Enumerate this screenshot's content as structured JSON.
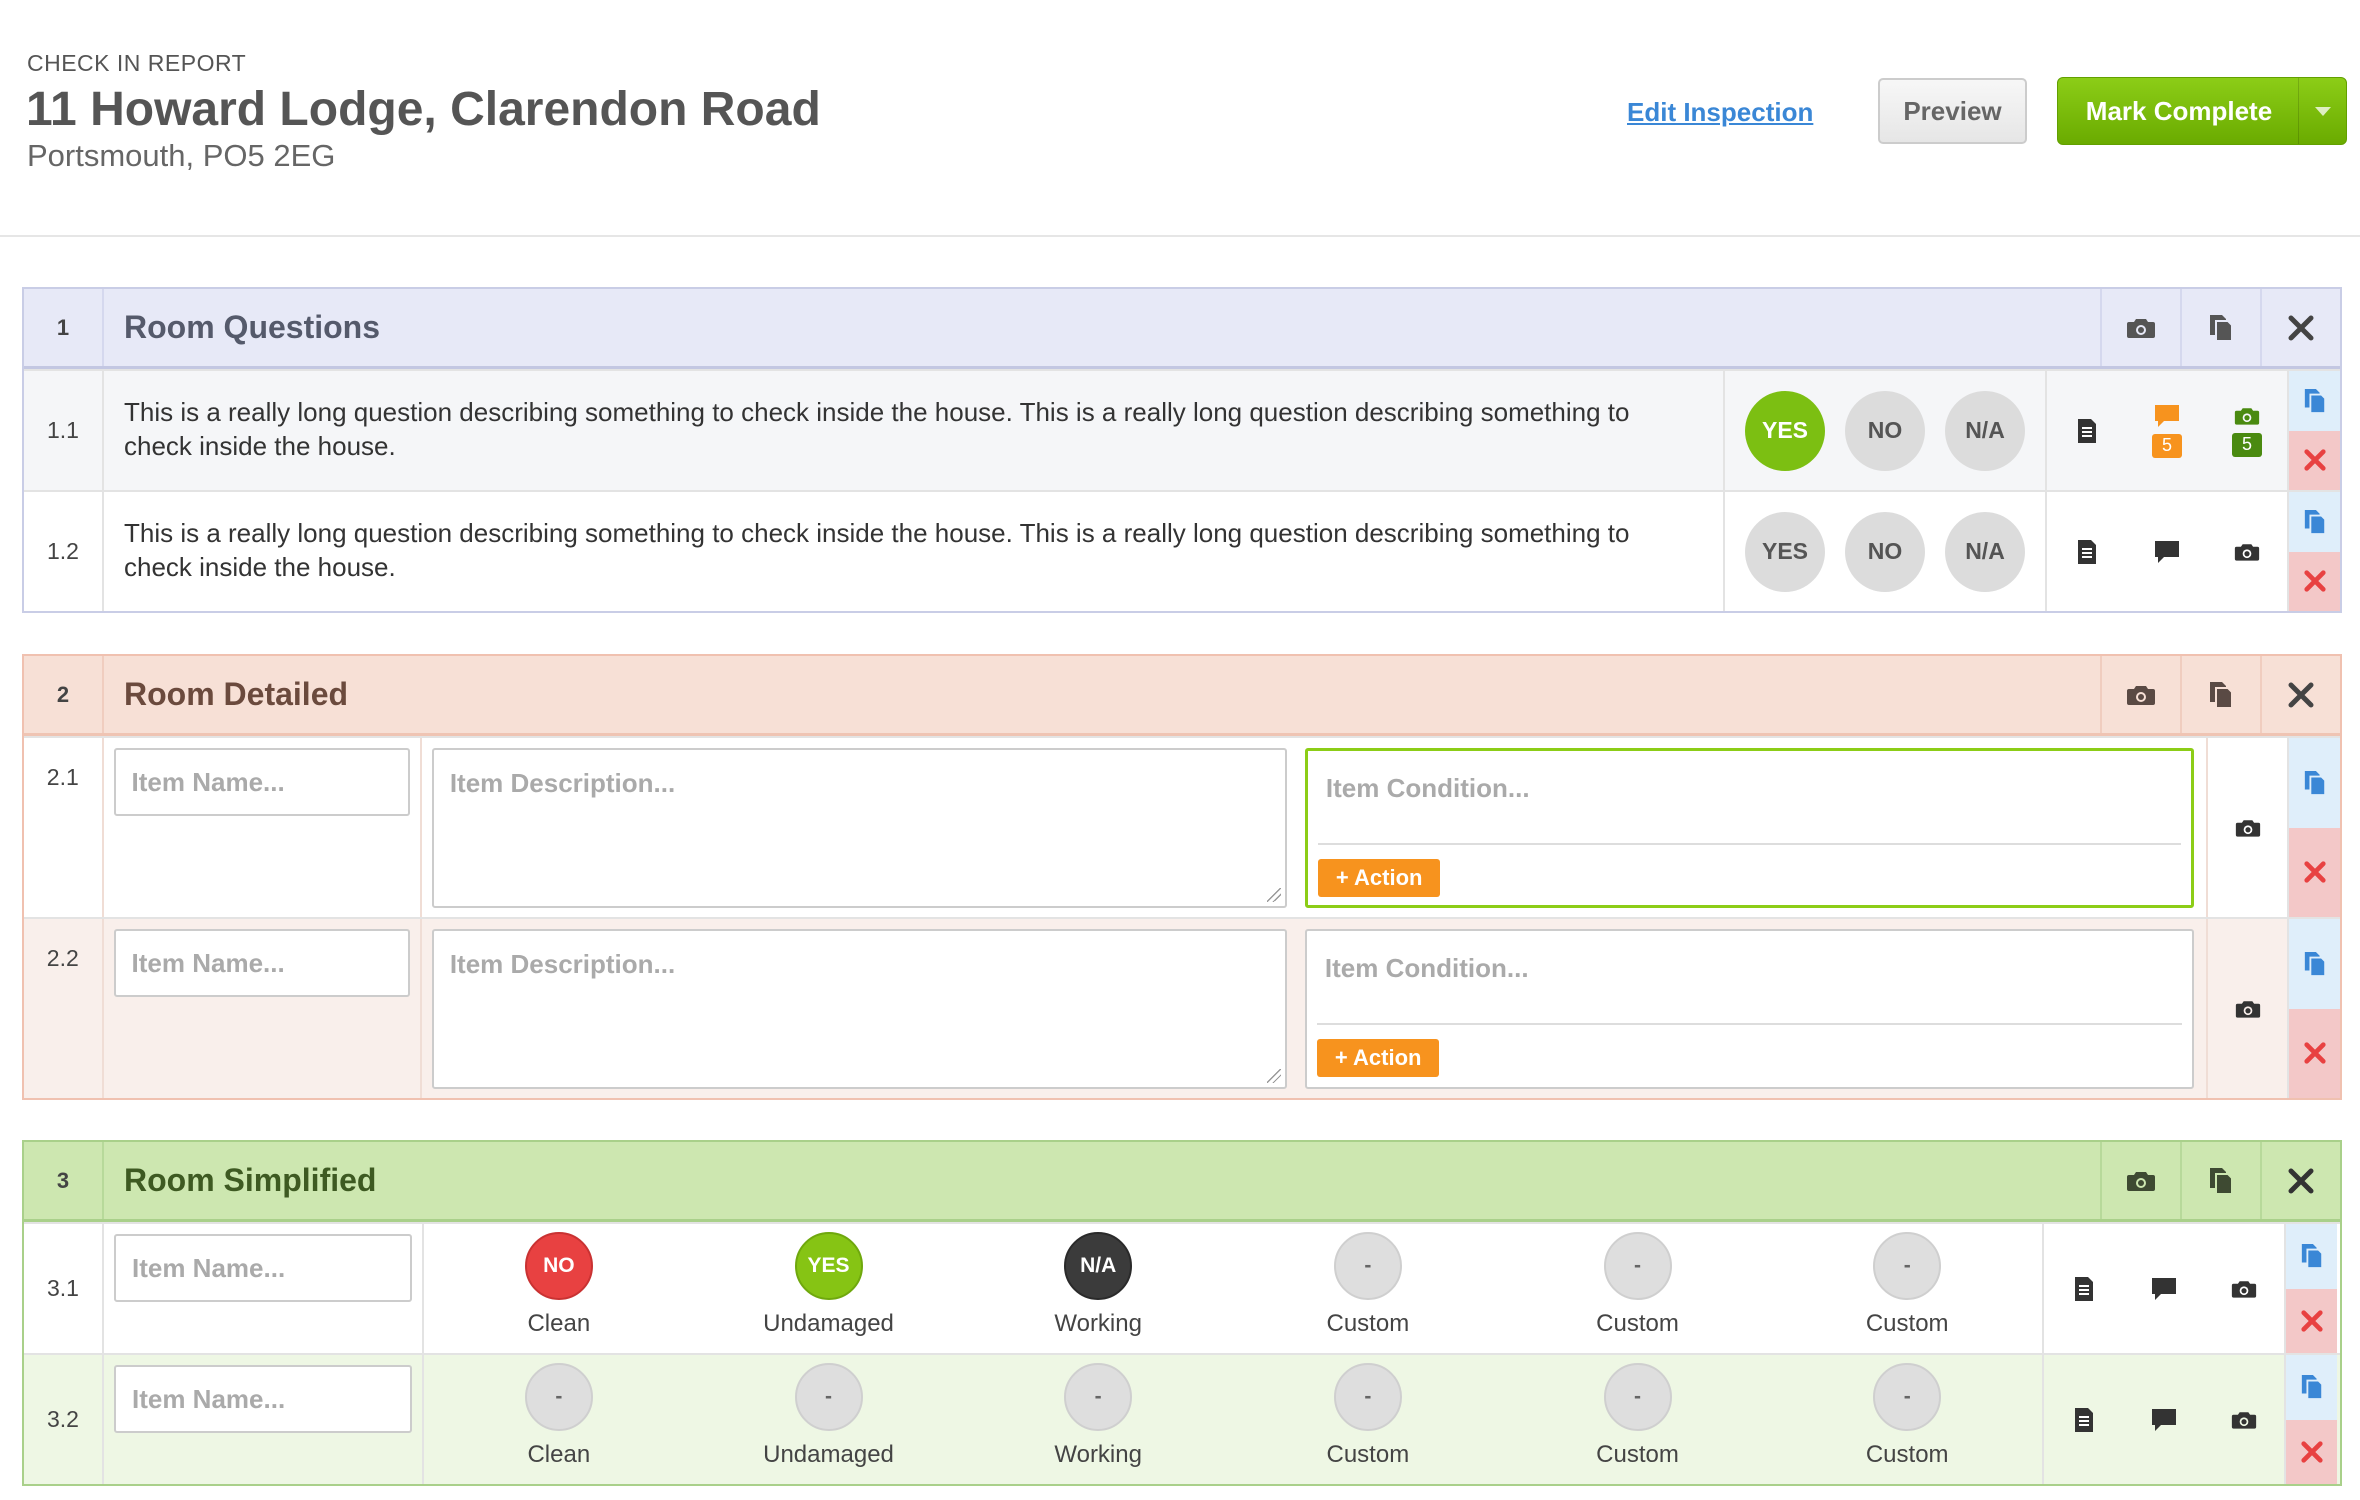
{
  "header": {
    "kicker": "CHECK IN REPORT",
    "title": "11 Howard Lodge, Clarendon Road",
    "subtitle": "Portsmouth, PO5 2EG",
    "edit_link": "Edit Inspection",
    "preview_label": "Preview",
    "complete_label": "Mark Complete"
  },
  "colors": {
    "accent_green": "#7cbf12",
    "link_blue": "#3a87d6",
    "action_orange": "#f7931e",
    "danger_red": "#e84141"
  },
  "section1": {
    "number": "1",
    "title": "Room Questions",
    "rows": [
      {
        "number": "1.1",
        "question": "This is a really long question describing something to check inside the house. This is a really long question describing something to check inside the house.",
        "yes": "YES",
        "no": "NO",
        "na": "N/A",
        "selected": "YES",
        "comment_count": "5",
        "photo_count": "5"
      },
      {
        "number": "1.2",
        "question": "This is a really long question describing something to check inside the house. This is a really long question describing something to check inside the house.",
        "yes": "YES",
        "no": "NO",
        "na": "N/A",
        "selected": ""
      }
    ]
  },
  "section2": {
    "number": "2",
    "title": "Room Detailed",
    "rows": [
      {
        "number": "2.1",
        "name_placeholder": "Item Name...",
        "desc_placeholder": "Item Description...",
        "cond_placeholder": "Item Condition...",
        "action_label": "+ Action"
      },
      {
        "number": "2.2",
        "name_placeholder": "Item Name...",
        "desc_placeholder": "Item Description...",
        "cond_placeholder": "Item Condition...",
        "action_label": "+ Action"
      }
    ]
  },
  "section3": {
    "number": "3",
    "title": "Room Simplified",
    "rows": [
      {
        "number": "3.1",
        "name_placeholder": "Item Name...",
        "options": [
          {
            "value": "NO",
            "label": "Clean"
          },
          {
            "value": "YES",
            "label": "Undamaged"
          },
          {
            "value": "N/A",
            "label": "Working"
          },
          {
            "value": "-",
            "label": "Custom"
          },
          {
            "value": "-",
            "label": "Custom"
          },
          {
            "value": "-",
            "label": "Custom"
          }
        ]
      },
      {
        "number": "3.2",
        "name_placeholder": "Item Name...",
        "options": [
          {
            "value": "-",
            "label": "Clean"
          },
          {
            "value": "-",
            "label": "Undamaged"
          },
          {
            "value": "-",
            "label": "Working"
          },
          {
            "value": "-",
            "label": "Custom"
          },
          {
            "value": "-",
            "label": "Custom"
          },
          {
            "value": "-",
            "label": "Custom"
          }
        ]
      }
    ]
  },
  "icons": {
    "camera": "camera-icon",
    "copy": "copy-icon",
    "close": "close-icon",
    "note": "note-icon",
    "comment": "comment-icon",
    "delete": "delete-icon"
  }
}
